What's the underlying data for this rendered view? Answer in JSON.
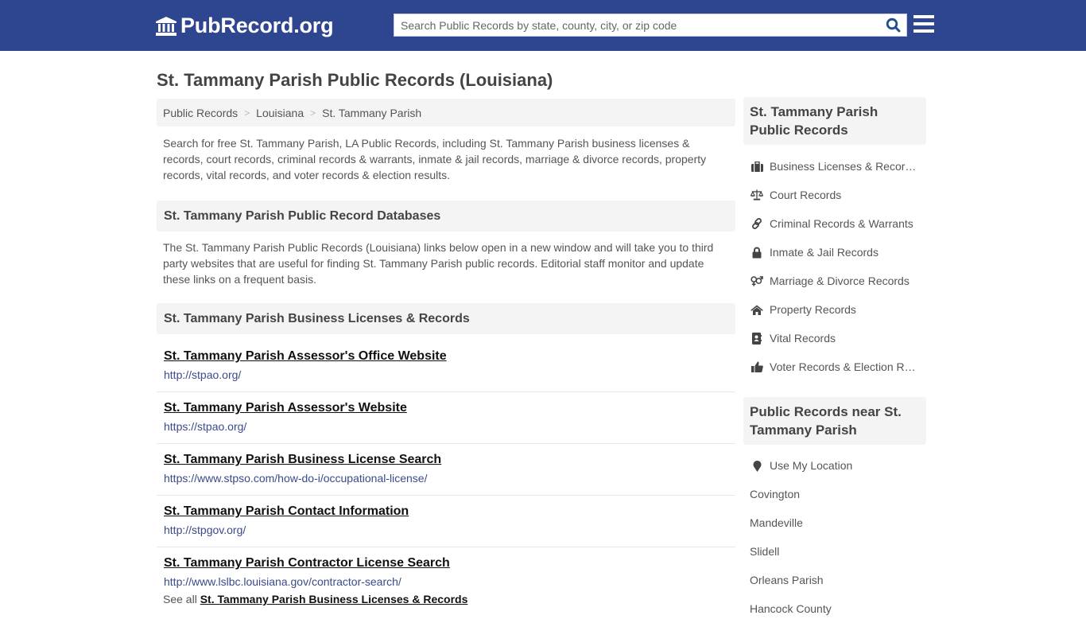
{
  "header": {
    "logo_text": "PubRecord.org",
    "search_placeholder": "Search Public Records by state, county, city, or zip code",
    "search_value": "",
    "brand_color": "#2e4590"
  },
  "page": {
    "title": "St. Tammany Parish Public Records (Louisiana)"
  },
  "breadcrumb": [
    {
      "label": "Public Records"
    },
    {
      "label": "Louisiana"
    },
    {
      "label": "St. Tammany Parish"
    }
  ],
  "breadcrumb_separator": ">",
  "intro": "Search for free St. Tammany Parish, LA Public Records, including St. Tammany Parish business licenses & records, court records, criminal records & warrants, inmate & jail records, marriage & divorce records, property records, vital records, and voter records & election results.",
  "databases": {
    "heading": "St. Tammany Parish Public Record Databases",
    "description": "The St. Tammany Parish Public Records (Louisiana) links below open in a new window and will take you to third party websites that are useful for finding St. Tammany Parish public records. Editorial staff monitor and update these links on a frequent basis."
  },
  "business": {
    "heading": "St. Tammany Parish Business Licenses & Records",
    "links": [
      {
        "title": "St. Tammany Parish Assessor's Office Website",
        "url": "http://stpao.org/"
      },
      {
        "title": "St. Tammany Parish Assessor's Website",
        "url": "https://stpao.org/"
      },
      {
        "title": "St. Tammany Parish Business License Search",
        "url": "https://www.stpso.com/how-do-i/occupational-license/"
      },
      {
        "title": "St. Tammany Parish Contact Information",
        "url": "http://stpgov.org/"
      },
      {
        "title": "St. Tammany Parish Contractor License Search",
        "url": "http://www.lslbc.louisiana.gov/contractor-search/"
      }
    ],
    "see_all_prefix": "See all",
    "see_all_link": "St. Tammany Parish Business Licenses & Records"
  },
  "sidebar": {
    "records_heading": "St. Tammany Parish Public Records",
    "records_items": [
      {
        "label": "Business Licenses & Records",
        "icon": "briefcase-icon"
      },
      {
        "label": "Court Records",
        "icon": "scale-icon"
      },
      {
        "label": "Criminal Records & Warrants",
        "icon": "link-icon"
      },
      {
        "label": "Inmate & Jail Records",
        "icon": "lock-icon"
      },
      {
        "label": "Marriage & Divorce Records",
        "icon": "gender-icon"
      },
      {
        "label": "Property Records",
        "icon": "home-icon"
      },
      {
        "label": "Vital Records",
        "icon": "contact-book-icon"
      },
      {
        "label": "Voter Records & Election Results",
        "icon": "thumbs-up-icon"
      }
    ],
    "near_heading": "Public Records near St. Tammany Parish",
    "use_location": "Use My Location",
    "near_items": [
      "Covington",
      "Mandeville",
      "Slidell",
      "Orleans Parish",
      "Hancock County"
    ]
  }
}
